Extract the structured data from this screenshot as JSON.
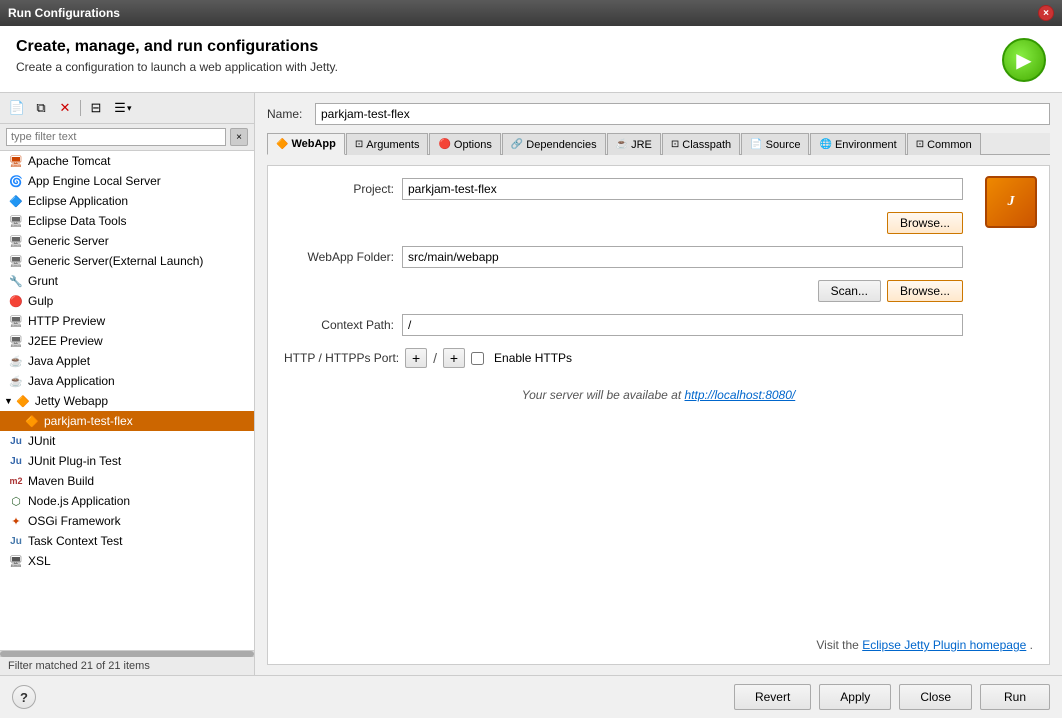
{
  "titleBar": {
    "title": "Run Configurations",
    "closeLabel": "×"
  },
  "header": {
    "heading": "Create, manage, and run configurations",
    "subheading": "Create a configuration to launch a web application with Jetty."
  },
  "toolbar": {
    "newBtn": "📄",
    "dupBtn": "📋",
    "delBtn": "✕",
    "filterBtn": "⊟",
    "moreBtn": "▾"
  },
  "filter": {
    "placeholder": "type filter text",
    "clearLabel": "×"
  },
  "treeItems": [
    {
      "id": "apache-tomcat",
      "label": "Apache Tomcat",
      "icon": "🖥",
      "indent": 8
    },
    {
      "id": "app-engine",
      "label": "App Engine Local Server",
      "icon": "🌀",
      "indent": 8
    },
    {
      "id": "eclipse-app",
      "label": "Eclipse Application",
      "icon": "🔷",
      "indent": 8
    },
    {
      "id": "eclipse-data",
      "label": "Eclipse Data Tools",
      "icon": "🖥",
      "indent": 8
    },
    {
      "id": "generic-server",
      "label": "Generic Server",
      "icon": "🖥",
      "indent": 8
    },
    {
      "id": "generic-server-ext",
      "label": "Generic Server(External Launch)",
      "icon": "🖥",
      "indent": 8
    },
    {
      "id": "grunt",
      "label": "Grunt",
      "icon": "🔧",
      "indent": 8
    },
    {
      "id": "gulp",
      "label": "Gulp",
      "icon": "🔴",
      "indent": 8
    },
    {
      "id": "http-preview",
      "label": "HTTP Preview",
      "icon": "🖥",
      "indent": 8
    },
    {
      "id": "j2ee-preview",
      "label": "J2EE Preview",
      "icon": "🖥",
      "indent": 8
    },
    {
      "id": "java-applet",
      "label": "Java Applet",
      "icon": "☕",
      "indent": 8
    },
    {
      "id": "java-application",
      "label": "Java Application",
      "icon": "☕",
      "indent": 8
    },
    {
      "id": "jetty-webapp",
      "label": "Jetty Webapp",
      "icon": "🔶",
      "indent": 4,
      "expanded": true,
      "isGroup": true
    },
    {
      "id": "parkjam-test-flex",
      "label": "parkjam-test-flex",
      "icon": "🔶",
      "indent": 16,
      "selected": true
    },
    {
      "id": "junit",
      "label": "JUnit",
      "icon": "Ju",
      "indent": 8
    },
    {
      "id": "junit-plugin",
      "label": "JUnit Plug-in Test",
      "icon": "Ju",
      "indent": 8
    },
    {
      "id": "maven-build",
      "label": "Maven Build",
      "icon": "m2",
      "indent": 8
    },
    {
      "id": "nodejs-app",
      "label": "Node.js Application",
      "icon": "⬡",
      "indent": 8
    },
    {
      "id": "osgi-framework",
      "label": "OSGi Framework",
      "icon": "🔶",
      "indent": 8
    },
    {
      "id": "task-context-test",
      "label": "Task Context Test",
      "icon": "Ju",
      "indent": 8
    },
    {
      "id": "xsl",
      "label": "XSL",
      "icon": "🖥",
      "indent": 8
    }
  ],
  "filterStatus": "Filter matched 21 of 21 items",
  "nameField": {
    "label": "Name:",
    "value": "parkjam-test-flex"
  },
  "tabs": [
    {
      "id": "webapp",
      "label": "WebApp",
      "icon": "🔶",
      "active": true
    },
    {
      "id": "arguments",
      "label": "Arguments",
      "icon": "⊡"
    },
    {
      "id": "options",
      "label": "Options",
      "icon": "🔴"
    },
    {
      "id": "dependencies",
      "label": "Dependencies",
      "icon": "🔗"
    },
    {
      "id": "jre",
      "label": "JRE",
      "icon": "☕"
    },
    {
      "id": "classpath",
      "label": "Classpath",
      "icon": "⊡"
    },
    {
      "id": "source",
      "label": "Source",
      "icon": "📄"
    },
    {
      "id": "environment",
      "label": "Environment",
      "icon": "🌐"
    },
    {
      "id": "common",
      "label": "Common",
      "icon": "⊡"
    }
  ],
  "webappConfig": {
    "projectLabel": "Project:",
    "projectValue": "parkjam-test-flex",
    "projectBrowse": "Browse...",
    "webappFolderLabel": "WebApp Folder:",
    "webappFolderValue": "src/main/webapp",
    "scanBtn": "Scan...",
    "browseFolderBtn": "Browse...",
    "contextPathLabel": "Context Path:",
    "contextPathValue": "/",
    "portLabel": "HTTP / HTTPPs Port:",
    "enableHttpsLabel": "Enable HTTPs",
    "serverAvailableText": "Your server will be availabe at ",
    "serverUrl": "http://localhost:8080/",
    "visitText": "Visit the ",
    "visitLink": "Eclipse Jetty Plugin homepage",
    "visitSuffix": "."
  },
  "bottomBar": {
    "helpLabel": "?",
    "revertLabel": "Revert",
    "applyLabel": "Apply",
    "closeLabel": "Close",
    "runLabel": "Run"
  }
}
